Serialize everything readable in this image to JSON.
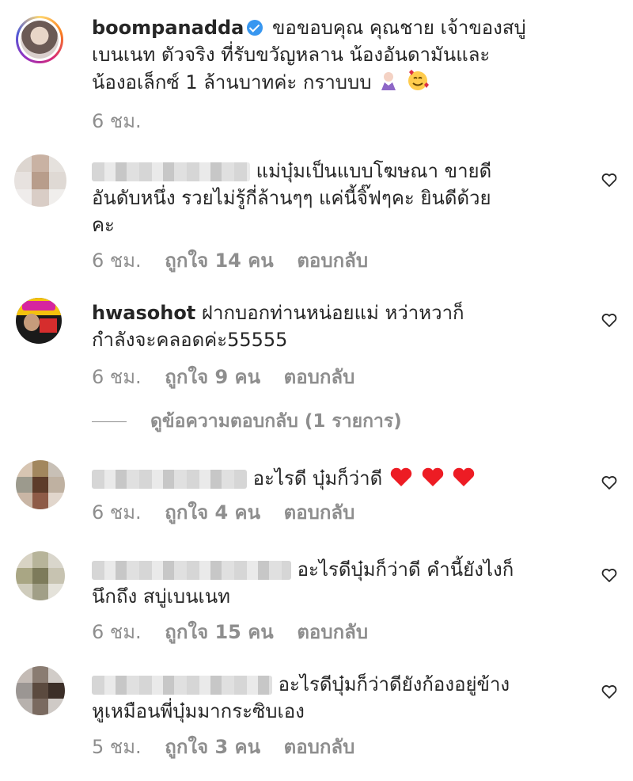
{
  "post_caption": {
    "username": "boompanadda",
    "text_line1": "ขอขอบคุณ คุณชาย เจ้าของสบู่",
    "text_line2": "เบนเนท ตัวจริง ที่รับขวัญหลาน น้องอันดามันและ",
    "text_line3": "น้องอเล็กซ์ 1 ล้านบาทค่ะ กราบบบ",
    "time": "6 ชม."
  },
  "comments": [
    {
      "username": "",
      "line1": "แม่บุ๋มเป็นแบบโฆษณา ขายดี",
      "line2": "อันดับหนึ่ง รวยไม่รู้กี่ล้านๆๆ แค่นี้จิ๊ฟๆคะ ยินดีด้วย",
      "line3": "คะ",
      "time": "6 ชม.",
      "likes": "ถูกใจ 14 คน",
      "reply": "ตอบกลับ"
    },
    {
      "username": "hwasohot",
      "line1": "ฝากบอกท่านหน่อยแม่ หว่าหวาก็",
      "line2": "กำลังจะคลอดค่ะ55555",
      "time": "6 ชม.",
      "likes": "ถูกใจ 9 คน",
      "reply": "ตอบกลับ"
    },
    {
      "username": "",
      "line1": "อะไรดี บุ๋มก็ว่าดี",
      "time": "6 ชม.",
      "likes": "ถูกใจ 4 คน",
      "reply": "ตอบกลับ"
    },
    {
      "username": "",
      "line1": "อะไรดีบุ๋มก็ว่าดี คำนี้ยังไงก็",
      "line2": "นึกถึง สบู่เบนเนท",
      "time": "6 ชม.",
      "likes": "ถูกใจ 15 คน",
      "reply": "ตอบกลับ"
    },
    {
      "username": "",
      "line1": "อะไรดีบุ๋มก็ว่าดียังก้องอยู่ข้าง",
      "line2": "หูเหมือนพี่บุ๋มมากระซิบเอง",
      "time": "5 ชม.",
      "likes": "ถูกใจ 3 คน",
      "reply": "ตอบกลับ"
    }
  ],
  "view_replies": "ดูข้อความตอบกลับ (1 รายการ)",
  "colors": {
    "text": "#262626",
    "muted": "#8e8e8e",
    "verified": "#3897f0",
    "heart_red": "#ed1c24",
    "story_ring": "#d6249f"
  },
  "icons": {
    "like": "heart-outline-icon",
    "verified": "verified-badge-icon",
    "emoji_heart": "red-heart-emoji"
  }
}
